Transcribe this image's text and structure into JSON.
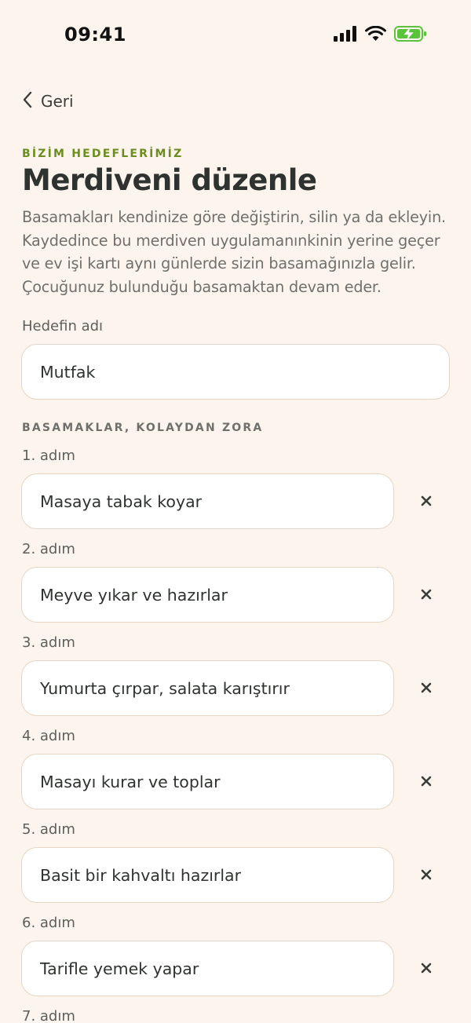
{
  "status_bar": {
    "time": "09:41"
  },
  "nav": {
    "back_label": "Geri"
  },
  "header": {
    "eyebrow": "BİZİM HEDEFLERİMİZ",
    "title": "Merdiveni düzenle",
    "description": "Basamakları kendinize göre değiştirin, silin ya da ekleyin. Kaydedince bu merdiven uygulamanınkinin yerine geçer ve ev işi kartı aynı günlerde sizin basamağınızla gelir. Çocuğunuz bulunduğu basamaktan devam eder."
  },
  "goal_name": {
    "label": "Hedefin adı",
    "value": "Mutfak"
  },
  "steps_section": {
    "label": "BASAMAKLAR, KOLAYDAN ZORA",
    "steps": [
      {
        "label": "1. adım",
        "value": "Masaya tabak koyar"
      },
      {
        "label": "2. adım",
        "value": "Meyve yıkar ve hazırlar"
      },
      {
        "label": "3. adım",
        "value": "Yumurta çırpar, salata karıştırır"
      },
      {
        "label": "4. adım",
        "value": "Masayı kurar ve toplar"
      },
      {
        "label": "5. adım",
        "value": "Basit bir kahvaltı hazırlar"
      },
      {
        "label": "6. adım",
        "value": "Tarifle yemek yapar"
      },
      {
        "label": "7. adım",
        "value": ""
      }
    ]
  },
  "colors": {
    "accent": "#6b8d1e",
    "background": "#fdf4ee",
    "border": "#e6d6c4",
    "battery": "#5ac33c"
  }
}
